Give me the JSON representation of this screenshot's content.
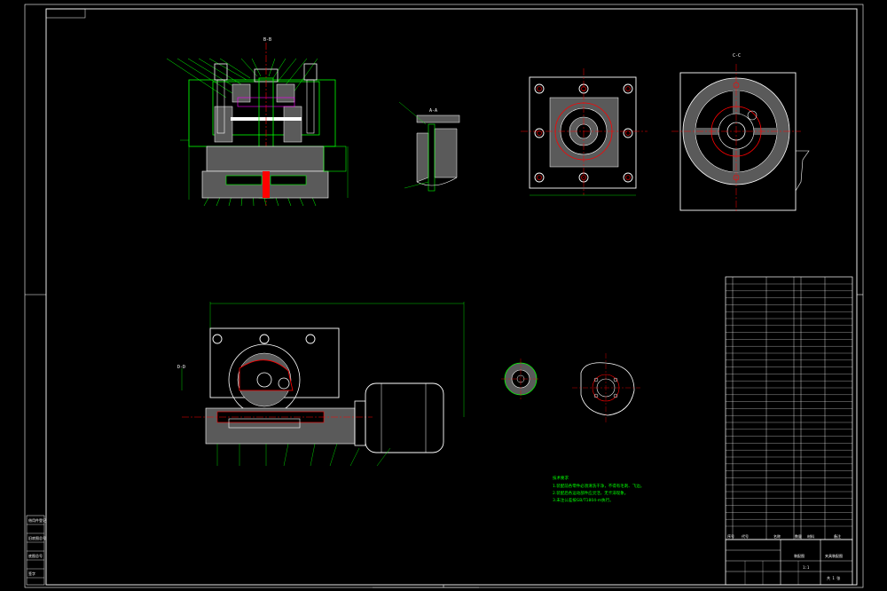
{
  "drawing": {
    "section_labels": {
      "top_view": "B-B",
      "side_view": "C-C",
      "detail": "A-A",
      "plan_view": "D-D"
    },
    "tech_notes": {
      "title": "技术要求",
      "lines": [
        "1.装配前各零件必须清洗干净，不得有毛刺、飞边。",
        "2.装配后各运动部件应灵活，无卡滞现象。",
        "3.未注公差按GB/T1804-m执行。"
      ]
    },
    "title_block": {
      "drawing_name": "夹具装配图",
      "company": "装配图",
      "scale_label": "1:1",
      "sheet_label": "共 1 张"
    },
    "bom_header": [
      "序号",
      "代号",
      "名称",
      "数量",
      "材料",
      "备注"
    ],
    "left_strip": [
      "借用件登记",
      "",
      "旧底图总号",
      "",
      "底图总号",
      "",
      "签字",
      "日期"
    ]
  },
  "colors": {
    "background": "#000000",
    "frame": "#ffffff",
    "outline": "#00ff00",
    "section": "#ffffff",
    "center": "#ff0000",
    "hidden": "#ffff00",
    "accent": "#ff00ff"
  }
}
